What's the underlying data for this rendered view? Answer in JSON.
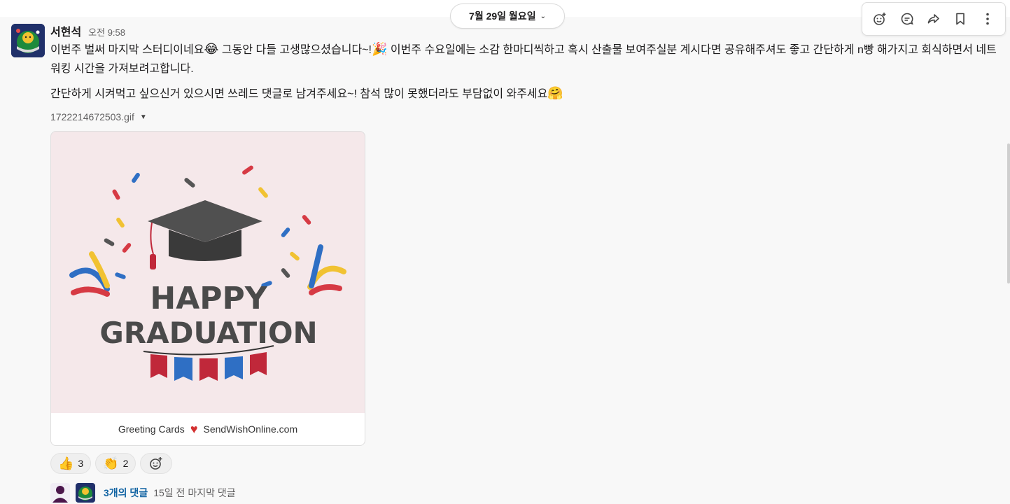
{
  "date_divider": {
    "label": "7월 29일 월요일"
  },
  "toolbar": {
    "icons": [
      "add-reaction-icon",
      "reply-thread-icon",
      "share-icon",
      "bookmark-icon",
      "more-icon"
    ]
  },
  "message": {
    "author": "서현석",
    "time": "오전 9:58",
    "para1_a": "이번주 벌써 마지막 스터디이네요",
    "para1_b": " 그동안 다들 고생많으셨습니다~!",
    "para1_c": " 이번주 수요일에는 소감 한마디씩하고 혹시 산출물 보여주실분 계시다면 공유해주셔도 좋고 간단하게 n빵 해가지고 회식하면서 네트워킹 시간을 가져보려고합니다.",
    "para2_a": "간단하게 시켜먹고 싶으신거 있으시면 쓰레드 댓글로 남겨주세요~! 참석 많이 못했더라도 부담없이 와주세요",
    "emoji_laugh": "😂",
    "emoji_party": "🎉",
    "emoji_hug": "🤗"
  },
  "attachment": {
    "filename": "1722214672503.gif",
    "image_text_line1": "HAPPY",
    "image_text_line2": "GRADUATION",
    "footer_left": "Greeting Cards",
    "footer_right": "SendWishOnline.com"
  },
  "reactions": [
    {
      "emoji": "👍",
      "count": "3"
    },
    {
      "emoji": "👏",
      "count": "2"
    }
  ],
  "thread": {
    "replies": "3개의 댓글",
    "last_reply": "15일 전 마지막 댓글"
  }
}
